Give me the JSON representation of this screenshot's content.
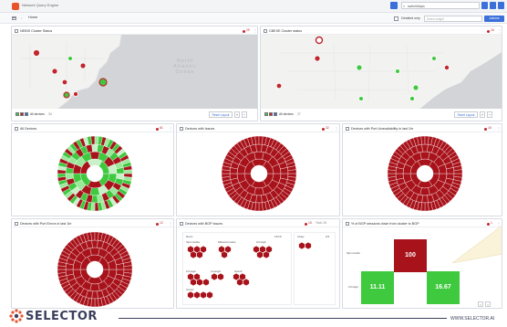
{
  "app": {
    "title": "Network Query Engine"
  },
  "topbar": {
    "search_value": "switchMaps"
  },
  "subbar": {
    "breadcrumb": "Home",
    "checkbox_label": "Detailed only",
    "input_placeholder": "Select widget",
    "actions_label": "Actions"
  },
  "panels": {
    "map_left": {
      "title": "NEBIS Cluster Status",
      "badge": "29",
      "ocean": "North\nAtlantic\nOcean",
      "footer_label": "All devices",
      "footer_count": "34",
      "reset_label": "Reset Layout"
    },
    "map_right": {
      "title": "CBEXE Cluster status",
      "badge": "16",
      "footer_label": "All devices",
      "footer_count": "27",
      "reset_label": "Reset Layout"
    },
    "sun_1": {
      "title": "All Devices",
      "badge": "61"
    },
    "sun_2": {
      "title": "Devices with Issues",
      "badge": "32"
    },
    "sun_3": {
      "title": "Devices with Port Unavailability in last 1hr",
      "badge": "18"
    },
    "sun_4": {
      "title": "Devices with Port Errors in last 1hr",
      "badge": "12"
    },
    "hex": {
      "title": "Devices with BGP Issues",
      "badge": "15",
      "badge_grey": "Total: 26",
      "group_left": "Devic",
      "group_left_count": "13/19",
      "group_right": "Likely",
      "group_right_count": "2/3",
      "row_labels": [
        "Sjmnmoble",
        "Mflessrmodule",
        "Lhrssgb",
        "Lhrssgb",
        "Lxxssgb",
        "Hssotl",
        "Crcssl"
      ]
    },
    "heatmap": {
      "title": "% of BGP sessions down from cluster to BGP",
      "badge": "1",
      "row_labels": [
        "Sjmnmoble",
        "Lhrssgb"
      ],
      "values": [
        "100",
        "11.11",
        "16.67"
      ]
    }
  },
  "footer": {
    "brand": "SELECTOR",
    "url": "WWW.SELECTOR.AI"
  },
  "colors": {
    "accent": "#3b6fd9",
    "critical": "#a8131b",
    "ok": "#3ec93e",
    "brand": "#3b3f5c"
  }
}
